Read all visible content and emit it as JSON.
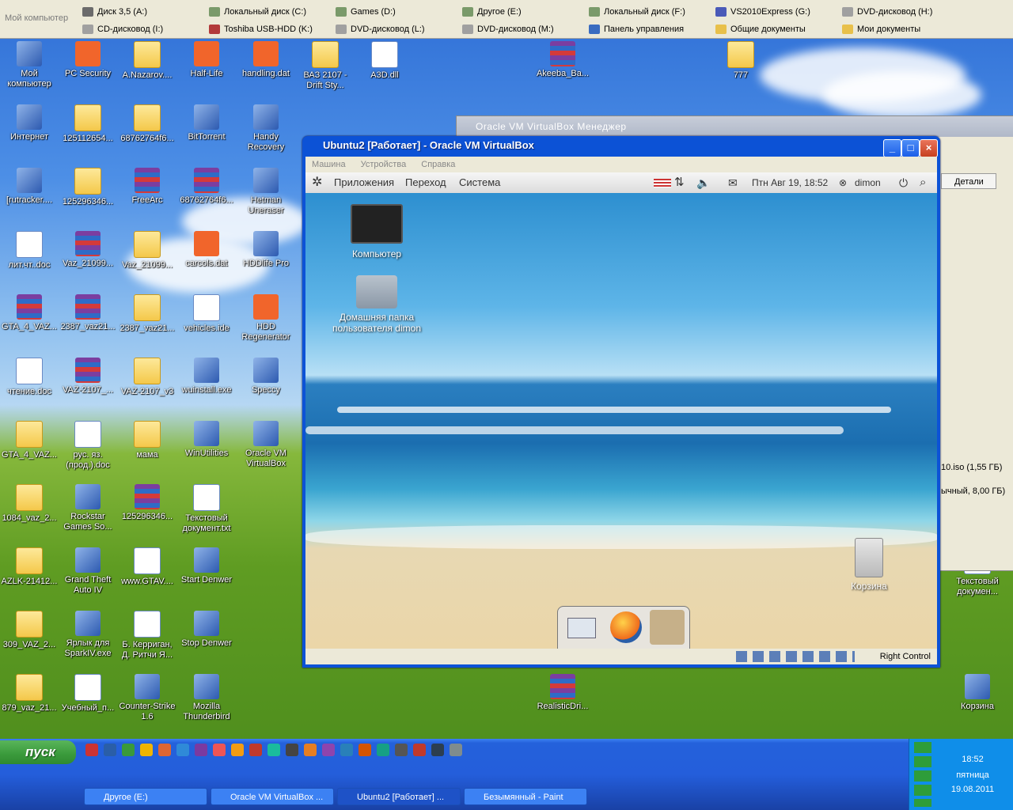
{
  "drivebar": {
    "title": "Мой компьютер",
    "drives": [
      {
        "label": "Диск 3,5 (A:)",
        "color": "#6b6b6b"
      },
      {
        "label": "CD-дисковод (I:)",
        "color": "#a0a0a0"
      },
      {
        "label": "Локальный диск (C:)",
        "color": "#7a9a6a"
      },
      {
        "label": "Toshiba USB-HDD (K:)",
        "color": "#b23a3a"
      },
      {
        "label": "Games (D:)",
        "color": "#7a9a6a"
      },
      {
        "label": "DVD-дисковод (L:)",
        "color": "#a0a0a0"
      },
      {
        "label": "Другое (E:)",
        "color": "#7a9a6a"
      },
      {
        "label": "DVD-дисковод (M:)",
        "color": "#a0a0a0"
      },
      {
        "label": "Локальный диск (F:)",
        "color": "#7a9a6a"
      },
      {
        "label": "Панель управления",
        "color": "#3a6cc0"
      },
      {
        "label": "VS2010Express (G:)",
        "color": "#4a5ab8"
      },
      {
        "label": "Общие документы",
        "color": "#e8c04a"
      },
      {
        "label": "DVD-дисковод (H:)",
        "color": "#a0a0a0"
      },
      {
        "label": "Мои документы",
        "color": "#e8c04a"
      }
    ]
  },
  "desktop_icons": [
    {
      "label": "Мой компьютер",
      "kind": "exe"
    },
    {
      "label": "PC Security",
      "kind": "dat"
    },
    {
      "label": "A.Nazarov....",
      "kind": "folder"
    },
    {
      "label": "Half-Life",
      "kind": "dat"
    },
    {
      "label": "handling.dat",
      "kind": "dat"
    },
    {
      "label": "ВАЗ 2107 - Drift Sty...",
      "kind": "folder"
    },
    {
      "label": "A3D.dll",
      "kind": "doc"
    },
    {
      "label": "Akeeba_Ba...",
      "kind": "rar"
    },
    {
      "label": "777",
      "kind": "folder"
    },
    {
      "label": "Интернет",
      "kind": "exe"
    },
    {
      "label": "125112654...",
      "kind": "folder"
    },
    {
      "label": "68762764f6...",
      "kind": "folder"
    },
    {
      "label": "BitTorrent",
      "kind": "exe"
    },
    {
      "label": "Handy Recovery",
      "kind": "exe"
    },
    {
      "label": "[rutracker....",
      "kind": "exe"
    },
    {
      "label": "125296346...",
      "kind": "folder"
    },
    {
      "label": "FreeArc",
      "kind": "rar"
    },
    {
      "label": "68762764f6...",
      "kind": "rar"
    },
    {
      "label": "Hetman Uneraser",
      "kind": "exe"
    },
    {
      "label": "лит.чт..doc",
      "kind": "doc"
    },
    {
      "label": "Vaz_21099...",
      "kind": "rar"
    },
    {
      "label": "Vaz_21099...",
      "kind": "folder"
    },
    {
      "label": "carcols.dat",
      "kind": "dat"
    },
    {
      "label": "HDDlife Pro",
      "kind": "exe"
    },
    {
      "label": "GTA_4_VAZ...",
      "kind": "rar"
    },
    {
      "label": "2387_vaz21...",
      "kind": "rar"
    },
    {
      "label": "2387_vaz21...",
      "kind": "folder"
    },
    {
      "label": "vehicles.ide",
      "kind": "doc"
    },
    {
      "label": "HDD Regenerator",
      "kind": "dat"
    },
    {
      "label": "чтение.doc",
      "kind": "doc"
    },
    {
      "label": "VAZ-2107_...",
      "kind": "rar"
    },
    {
      "label": "VAZ-2107_v3",
      "kind": "folder"
    },
    {
      "label": "wuinstall.exe",
      "kind": "exe"
    },
    {
      "label": "Speccy",
      "kind": "exe"
    },
    {
      "label": "GTA_4_VAZ...",
      "kind": "folder"
    },
    {
      "label": "рус. яз. (прод.).doc",
      "kind": "doc"
    },
    {
      "label": "мама",
      "kind": "folder"
    },
    {
      "label": "WinUtilities",
      "kind": "exe"
    },
    {
      "label": "Oracle VM VirtualBox",
      "kind": "exe"
    },
    {
      "label": "1084_vaz_2...",
      "kind": "folder"
    },
    {
      "label": "Rockstar Games So...",
      "kind": "exe"
    },
    {
      "label": "125296346...",
      "kind": "rar"
    },
    {
      "label": "Текстовый документ.txt",
      "kind": "doc"
    },
    {
      "label": "AZLK-21412...",
      "kind": "folder"
    },
    {
      "label": "Grand Theft Auto IV",
      "kind": "exe"
    },
    {
      "label": "www.GTAV....",
      "kind": "doc"
    },
    {
      "label": "Start Denwer",
      "kind": "exe"
    },
    {
      "label": "309_VAZ_2...",
      "kind": "folder"
    },
    {
      "label": "Ярлык для SparkIV.exe",
      "kind": "exe"
    },
    {
      "label": "Б. Керриган, Д. Ритчи Я...",
      "kind": "doc"
    },
    {
      "label": "Stop Denwer",
      "kind": "exe"
    },
    {
      "label": "879_vaz_21...",
      "kind": "folder"
    },
    {
      "label": "Учебный_п...",
      "kind": "doc"
    },
    {
      "label": "Counter-Strike 1.6",
      "kind": "exe"
    },
    {
      "label": "Mozilla Thunderbird",
      "kind": "exe"
    },
    {
      "label": "RealisticDri...",
      "kind": "rar"
    },
    {
      "label": "Текстовый докумен...",
      "kind": "doc"
    },
    {
      "label": "Корзина",
      "kind": "exe"
    }
  ],
  "manager": {
    "title": "Oracle VM VirtualBox Менеджер",
    "details_button": "Детали",
    "iso_info": "10.iso (1,55 ГБ)",
    "disk_info": "ычный, 8,00 ГБ)"
  },
  "vm": {
    "title": "Ubuntu2 [Работает] - Oracle VM VirtualBox",
    "menu": [
      "Машина",
      "Устройства",
      "Справка"
    ],
    "status_hostkey": "Right Control"
  },
  "ubuntu": {
    "panel_menu": [
      "Приложения",
      "Переход",
      "Система"
    ],
    "datetime": "Птн Авг 19, 18:52",
    "user": "dimon",
    "icons": {
      "computer": "Компьютер",
      "home": "Домашняя папка пользователя dimon",
      "trash": "Корзина"
    }
  },
  "taskbar": {
    "start_label": "пуск",
    "tasks": [
      "Другое (E:)",
      "Oracle VM VirtualBox ...",
      "Ubuntu2 [Работает] ...",
      "Безымянный - Paint"
    ],
    "clock_time": "18:52",
    "clock_day": "пятница",
    "clock_date": "19.08.2011"
  }
}
